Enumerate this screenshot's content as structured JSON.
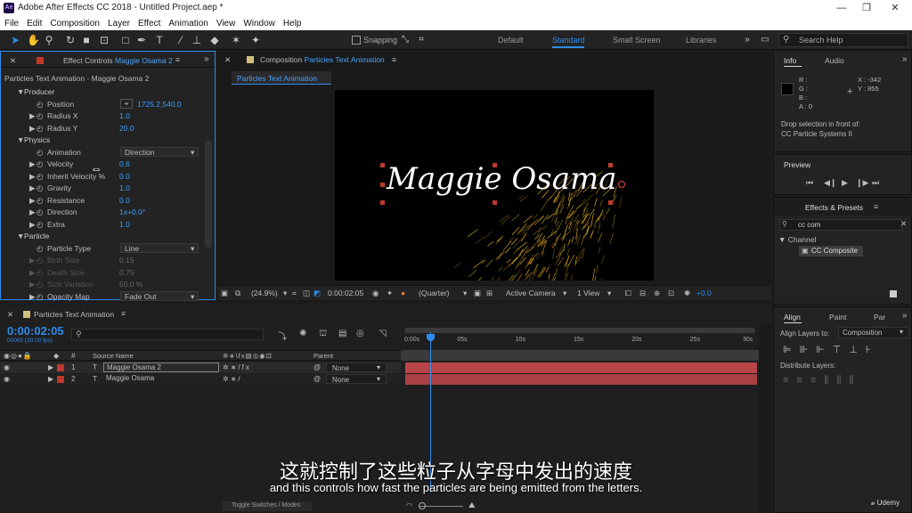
{
  "app": {
    "logo": "Ae",
    "title": "Adobe After Effects CC 2018 - Untitled Project.aep *",
    "win_min": "—",
    "win_max": "❐",
    "win_close": "✕"
  },
  "menu": [
    "File",
    "Edit",
    "Composition",
    "Layer",
    "Effect",
    "Animation",
    "View",
    "Window",
    "Help"
  ],
  "toolbar": {
    "snapping": "Snapping",
    "workspaces": [
      "Default",
      "Standard",
      "Small Screen",
      "Libraries"
    ],
    "search_placeholder": "Search Help"
  },
  "effect_controls": {
    "tab_prefix": "Effect Controls",
    "tab_layer": "Maggie Osama 2",
    "header": "Particles Text Animation - Maggie Osama 2",
    "rows": [
      {
        "indent": 0,
        "tri": "▼",
        "label": "Producer",
        "value": "",
        "kind": "group"
      },
      {
        "indent": 2,
        "tri": "",
        "label": "Position",
        "value": "1725.2,540.0",
        "kind": "pos"
      },
      {
        "indent": 2,
        "tri": "▶",
        "label": "Radius X",
        "value": "1.0",
        "kind": "num"
      },
      {
        "indent": 2,
        "tri": "▶",
        "label": "Radius Y",
        "value": "20.0",
        "kind": "num"
      },
      {
        "indent": 0,
        "tri": "▼",
        "label": "Physics",
        "value": "",
        "kind": "group"
      },
      {
        "indent": 2,
        "tri": "",
        "label": "Animation",
        "value": "Direction",
        "kind": "dd"
      },
      {
        "indent": 2,
        "tri": "▶",
        "label": "Velocity",
        "value": "0.6",
        "kind": "num"
      },
      {
        "indent": 2,
        "tri": "▶",
        "label": "Inherit Velocity %",
        "value": "0.0",
        "kind": "num"
      },
      {
        "indent": 2,
        "tri": "▶",
        "label": "Gravity",
        "value": "1.0",
        "kind": "num"
      },
      {
        "indent": 2,
        "tri": "▶",
        "label": "Resistance",
        "value": "0.0",
        "kind": "num"
      },
      {
        "indent": 2,
        "tri": "▶",
        "label": "Direction",
        "value": "1x+0.0°",
        "kind": "num"
      },
      {
        "indent": 2,
        "tri": "▶",
        "label": "Extra",
        "value": "1.0",
        "kind": "num"
      },
      {
        "indent": 0,
        "tri": "▼",
        "label": "Particle",
        "value": "",
        "kind": "group"
      },
      {
        "indent": 2,
        "tri": "",
        "label": "Particle Type",
        "value": "Line",
        "kind": "dd"
      },
      {
        "indent": 2,
        "tri": "▶",
        "label": "Birth Size",
        "value": "0.15",
        "kind": "dim"
      },
      {
        "indent": 2,
        "tri": "▶",
        "label": "Death Size",
        "value": "0.75",
        "kind": "dim"
      },
      {
        "indent": 2,
        "tri": "▶",
        "label": "Size Variation",
        "value": "50.0 %",
        "kind": "dim"
      },
      {
        "indent": 2,
        "tri": "▶",
        "label": "Opacity Map",
        "value": "Fade Out",
        "kind": "dd"
      }
    ]
  },
  "composition": {
    "tab_prefix": "Composition",
    "tab_name": "Particles Text Animation",
    "subtab": "Particles Text Animation",
    "canvas_text": "Maggie Osama",
    "zoom": "(24.9%)",
    "timecode": "0:00:02:05",
    "resolution": "(Quarter)",
    "camera": "Active Camera",
    "views": "1 View",
    "exposure": "+0.0"
  },
  "info": {
    "tab": "Info",
    "tab2": "Audio",
    "r": "R :",
    "g": "G :",
    "b": "B :",
    "a": "A : 0",
    "x": "X : -342",
    "y": "Y : 855",
    "drop_text_1": "Drop selection in front of:",
    "drop_text_2": "CC Particle Systems II"
  },
  "preview": {
    "tab": "Preview"
  },
  "effects_presets": {
    "tab": "Effects & Presets",
    "search": "cc com",
    "group": "Channel",
    "item": "CC Composite"
  },
  "align": {
    "tab": "Align",
    "tab2": "Paint",
    "tab3": "Par",
    "label": "Align Layers to:",
    "value": "Composition",
    "distribute": "Distribute Layers:"
  },
  "timeline": {
    "tab": "Particles Text Animation",
    "timecode": "0:00:02:05",
    "fps": "00065 (30.00 fps)",
    "col_num": "#",
    "col_source": "Source Name",
    "col_parent": "Parent",
    "ruler": [
      "0:00s",
      "05s",
      "10s",
      "15s",
      "20s",
      "25s",
      "30s"
    ],
    "layers": [
      {
        "num": "1",
        "type": "T",
        "name": "Maggie Osama 2",
        "parent": "None",
        "selected": true
      },
      {
        "num": "2",
        "type": "T",
        "name": "Maggie Osama",
        "parent": "None",
        "selected": false
      }
    ],
    "toggle": "Toggle Switches / Modes"
  },
  "subtitles": {
    "cn": "这就控制了这些粒子从字母中发出的速度",
    "en": "and this controls how fast the particles are being emitted from the letters.",
    "watermark": "Udemy"
  },
  "colors": {
    "accent": "#2d8ceb",
    "layer_label": "#c0392b",
    "track": "#b94447",
    "particles": "#d8a520"
  }
}
